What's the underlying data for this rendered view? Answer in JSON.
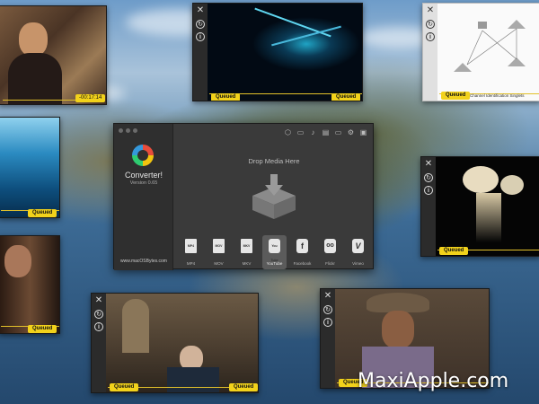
{
  "players": {
    "top_left": {
      "time": "-00:17:14"
    },
    "top_center": {
      "left_status": "Queued",
      "right_status": "Queued"
    },
    "top_right": {
      "left_status": "Queued",
      "caption": "Channel Identification Singlets"
    },
    "mid_left": {
      "status": "Queued"
    },
    "right_middle": {
      "status": "Queued"
    },
    "bottom_left": {
      "status": "Queued"
    },
    "bottom_center": {
      "left_status": "Queued",
      "right_status": "Queued"
    },
    "bottom_right": {
      "left_status": "Queued"
    }
  },
  "converter": {
    "app_name": "Converter!",
    "version": "Version 0.65",
    "site_link": "www.macOSBytes.com",
    "drop_label": "Drop Media Here",
    "formats": [
      {
        "label": "MP4",
        "icon": "MP4"
      },
      {
        "label": "MOV",
        "icon": "MOV"
      },
      {
        "label": "MKV",
        "icon": "MKV"
      },
      {
        "label": "YouTube",
        "icon": "You Tube"
      },
      {
        "label": "Facebook",
        "icon": "f"
      },
      {
        "label": "Flickr",
        "icon": "oo"
      },
      {
        "label": "Vimeo",
        "icon": "V"
      }
    ],
    "selected_format": "YouTube",
    "toolbar_icons": [
      "cube-icon",
      "camera-icon",
      "volume-icon",
      "subtitle-icon",
      "monitor-icon",
      "gear-icon",
      "save-icon"
    ]
  },
  "watermark": "MaxiApple.com",
  "colors": {
    "badge": "#f2d21b",
    "window": "#3a3a3a",
    "sidebar": "#2f2f2f"
  }
}
